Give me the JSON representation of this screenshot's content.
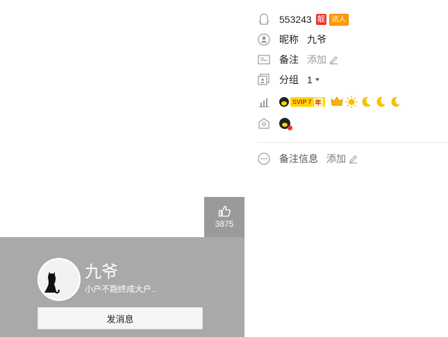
{
  "profile": {
    "likes": "3875",
    "nickname": "九爷",
    "signature": "小户不跑终成大户..",
    "send_message_label": "发消息"
  },
  "info": {
    "qq_number": "553243",
    "pretty_badge": "靓",
    "expert_badge": "达人",
    "nickname_label": "昵称",
    "nickname_value": "九爷",
    "remark_label": "备注",
    "remark_add": "添加",
    "group_label": "分组",
    "group_value": "1",
    "svip_label": "SVIP",
    "svip_years": "7",
    "svip_year_unit": "年",
    "note_label": "备注信息",
    "note_add": "添加"
  },
  "colors": {
    "card_bg": "#a9a9a9",
    "like_bg": "#9a9a9a",
    "red_badge": "#ee3333",
    "orange_badge": "#ff9b00"
  }
}
